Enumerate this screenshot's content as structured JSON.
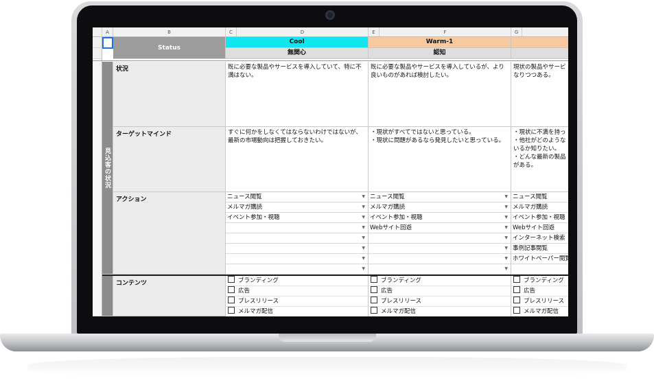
{
  "sheet": {
    "columns": [
      "A",
      "B",
      "C",
      "D",
      "E",
      "F",
      "G"
    ],
    "header": {
      "status": "Status",
      "stages": [
        {
          "name": "Cool",
          "sub": "無関心",
          "color": "#11e6ef"
        },
        {
          "name": "Warm-1",
          "sub": "認知",
          "color": "#f7c9a1"
        },
        {
          "name": "",
          "sub": "",
          "color": "#f7c9a1"
        }
      ]
    },
    "group_label": "見込客の状況",
    "rows": {
      "status_label": "状況",
      "status_texts": [
        "既に必要な製品やサービスを導入していて、特に不満はない。",
        "既に必要な製品やサービスを導入しているが、より良いものがあれば検討したい。",
        "現状の製品やサービ\nなりつつある。"
      ],
      "mind_label": "ターゲットマインド",
      "mind_texts": [
        "すぐに何かをしなくてはならないわけではないが、最新の市場動向は把握しておきたい。",
        "・現状がすべてではないと思っている。\n・現状に問題があるなら発見したいと思っている。",
        "・現状に不満を持っ\n・他社がどのような\nいるか知りたい。\n・どんな最新の製品\nがある。"
      ],
      "action_label": "アクション",
      "actions": [
        [
          "ニュース閲覧",
          "メルマガ購読",
          "イベント参加・視聴",
          "",
          "",
          "",
          "",
          ""
        ],
        [
          "ニュース閲覧",
          "メルマガ購読",
          "イベント参加・視聴",
          "Webサイト回遊",
          "",
          "",
          "",
          ""
        ],
        [
          "ニュース閲覧",
          "メルマガ購読",
          "イベント参加・視聴",
          "Webサイト回遊",
          "インターネット検索",
          "事例記事閲覧",
          "ホワイトペーパー閲覧",
          ""
        ]
      ],
      "content_label": "コンテンツ",
      "contents": [
        "ブランディング",
        "広告",
        "プレスリリース",
        "メルマガ配信"
      ]
    }
  }
}
